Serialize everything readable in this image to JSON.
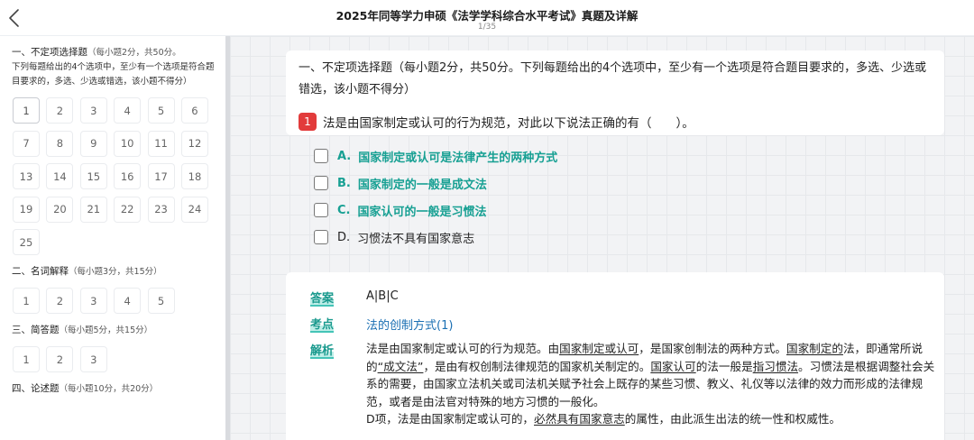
{
  "header": {
    "title": "2025年同等学力申硕《法学学科综合水平考试》真题及详解",
    "page": "1/35"
  },
  "sidebar": {
    "sections": [
      {
        "title": "一、不定项选择题",
        "sub": "（每小题2分，共50分。",
        "desc": "下列每题给出的4个选项中，至少有一个选项是符合题目要求的，多选、少选或错选，该小题不得分）",
        "numbers": [
          "1",
          "2",
          "3",
          "4",
          "5",
          "6",
          "7",
          "8",
          "9",
          "10",
          "11",
          "12",
          "13",
          "14",
          "15",
          "16",
          "17",
          "18",
          "19",
          "20",
          "21",
          "22",
          "23",
          "24",
          "25"
        ]
      },
      {
        "title": "二、名词解释",
        "sub": "（每小题3分，共15分）",
        "numbers": [
          "1",
          "2",
          "3",
          "4",
          "5"
        ]
      },
      {
        "title": "三、简答题",
        "sub": "（每小题5分，共15分）",
        "numbers": [
          "1",
          "2",
          "3"
        ]
      },
      {
        "title": "四、论述题",
        "sub": "（每小题10分，共20分）",
        "numbers": []
      }
    ]
  },
  "main": {
    "section_intro": "一、不定项选择题（每小题2分，共50分。下列每题给出的4个选项中，至少有一个选项是符合题目要求的，多选、少选或错选，该小题不得分）",
    "question": {
      "number": "1",
      "text": "法是由国家制定或认可的行为规范，对此以下说法正确的有（　　）。"
    },
    "options": [
      {
        "letter": "A.",
        "text": "国家制定或认可是法律产生的两种方式"
      },
      {
        "letter": "B.",
        "text": "国家制定的一般是成文法"
      },
      {
        "letter": "C.",
        "text": "国家认可的一般是习惯法"
      },
      {
        "letter": "D.",
        "text": "习惯法不具有国家意志"
      }
    ],
    "analysis": {
      "answer_label": "答案",
      "answer_value": "A|B|C",
      "point_label": "考点",
      "point_value": "法的创制方式(1)",
      "explain_label": "解析",
      "explain_p1": {
        "t1": "法是由国家制定或认可的行为规范。由",
        "u1": "国家制定或认可",
        "t2": "，是国家创制法的两种方式。",
        "u2": "国家制定的",
        "t3": "法，即通常所说的",
        "u3": "“成文法”",
        "t4": "，是由有权创制法律规范的国家机关制定的。",
        "u4": "国家认可",
        "t5": "的法一般是",
        "u5": "指习惯法",
        "t6": "。习惯法是根据调整社会关系的需要，由国家立法机关或司法机关赋予社会上既存的某些习惯、教义、礼仪等以法律的效力而形成的法律规范，或者是由法官对特殊的地方习惯的一般化。"
      },
      "explain_p2": {
        "t1": "D项，法是由国家制定或认可的，",
        "u1": "必然具有国家意志",
        "t2": "的属性，由此派生出法的统一性和权威性。"
      }
    }
  }
}
